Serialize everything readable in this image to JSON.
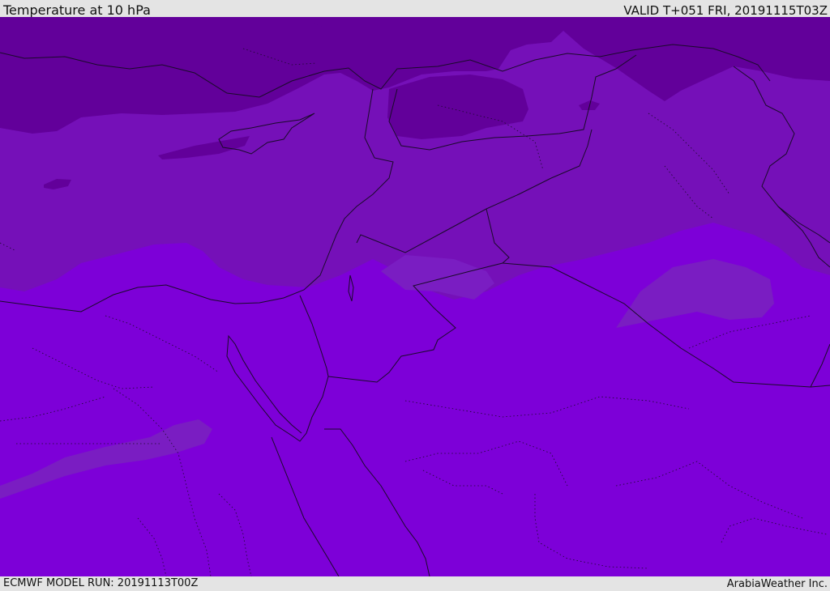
{
  "header": {
    "title": "Temperature at 10 hPa",
    "valid": "VALID T+051 FRI, 20191115T03Z"
  },
  "footer": {
    "model_run": "ECMWF MODEL RUN: 20191113T00Z",
    "credit": "ArabiaWeather Inc."
  },
  "colors": {
    "band_coldest": "#62009a",
    "band_cold": "#7510b8",
    "band_base": "#7d00d8",
    "band_patch": "#7a1dc2",
    "border": "#1a0a2a"
  }
}
